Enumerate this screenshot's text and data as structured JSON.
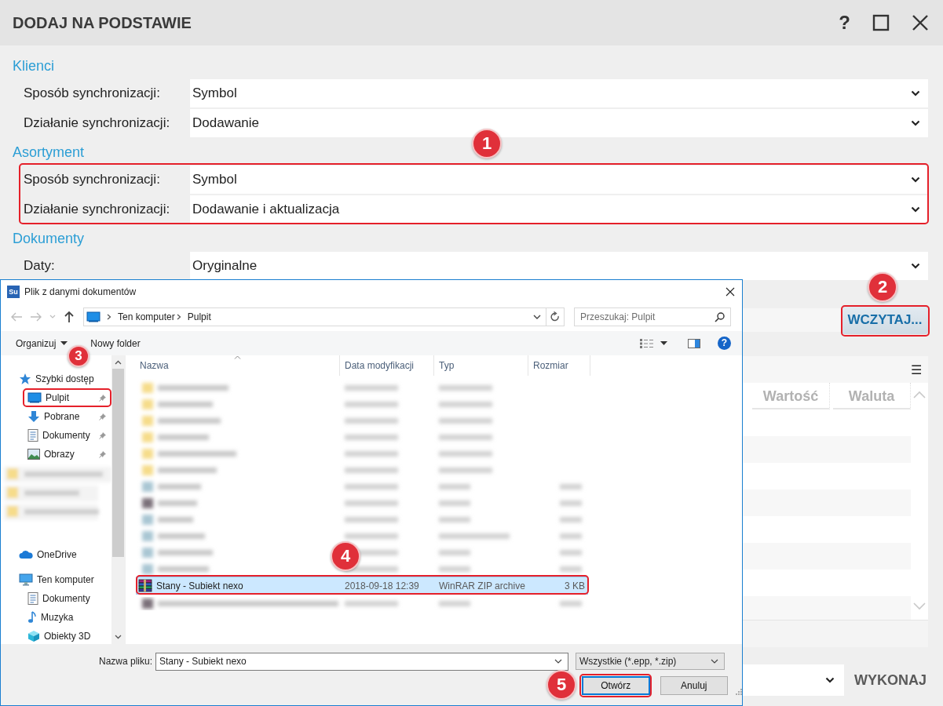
{
  "window": {
    "title": "DODAJ NA PODSTAWIE",
    "help": "?"
  },
  "sections": [
    {
      "heading": "Klienci",
      "fields": [
        {
          "label": "Sposób synchronizacji:",
          "value": "Symbol"
        },
        {
          "label": "Działanie synchronizacji:",
          "value": "Dodawanie"
        }
      ]
    },
    {
      "heading": "Asortyment",
      "fields": [
        {
          "label": "Sposób synchronizacji:",
          "value": "Symbol"
        },
        {
          "label": "Działanie synchronizacji:",
          "value": "Dodawanie i aktualizacja"
        }
      ]
    },
    {
      "heading": "Dokumenty",
      "fields": [
        {
          "label": "Daty:",
          "value": "Oryginalne"
        }
      ]
    }
  ],
  "load_button": "WCZYTAJ...",
  "table": {
    "menu": "☰",
    "columns": [
      "Wartość",
      "Waluta"
    ]
  },
  "execute_button": "WYKONAJ",
  "dialog": {
    "app_icon": "Su",
    "title": "Plik z danymi dokumentów",
    "address": [
      "Ten komputer",
      "Pulpit"
    ],
    "search_placeholder": "Przeszukaj: Pulpit",
    "toolbar": [
      "Organizuj",
      "Nowy folder"
    ],
    "help": "?",
    "nav_items": [
      {
        "label": "Szybki dostęp",
        "kind": "star",
        "pinned": false,
        "children": [
          {
            "label": "Pulpit",
            "kind": "desktop",
            "pinned": true
          },
          {
            "label": "Pobrane",
            "kind": "download",
            "pinned": true
          },
          {
            "label": "Dokumenty",
            "kind": "document",
            "pinned": true
          },
          {
            "label": "Obrazy",
            "kind": "pictures",
            "pinned": true
          }
        ]
      },
      {
        "label": "OneDrive",
        "kind": "cloud",
        "pinned": false
      },
      {
        "label": "Ten komputer",
        "kind": "computer",
        "pinned": false,
        "children": [
          {
            "label": "Dokumenty",
            "kind": "document",
            "pinned": false
          },
          {
            "label": "Muzyka",
            "kind": "music",
            "pinned": false
          },
          {
            "label": "Obiekty 3D",
            "kind": "cube",
            "pinned": false
          }
        ]
      }
    ],
    "columns": [
      "Nazwa",
      "Data modyfikacji",
      "Typ",
      "Rozmiar"
    ],
    "files": [
      {
        "name": "Stany - Subiekt nexo",
        "date": "2018-09-18 12:39",
        "type": "WinRAR ZIP archive",
        "size": "3 KB",
        "selected": true
      }
    ],
    "filename_label": "Nazwa pliku:",
    "filename": "Stany - Subiekt nexo",
    "filter": "Wszystkie (*.epp, *.zip)",
    "buttons": [
      "Otwórz",
      "Anuluj"
    ]
  },
  "annotations": [
    {
      "number": "1"
    },
    {
      "number": "2"
    },
    {
      "number": "3"
    },
    {
      "number": "4"
    },
    {
      "number": "5"
    }
  ]
}
